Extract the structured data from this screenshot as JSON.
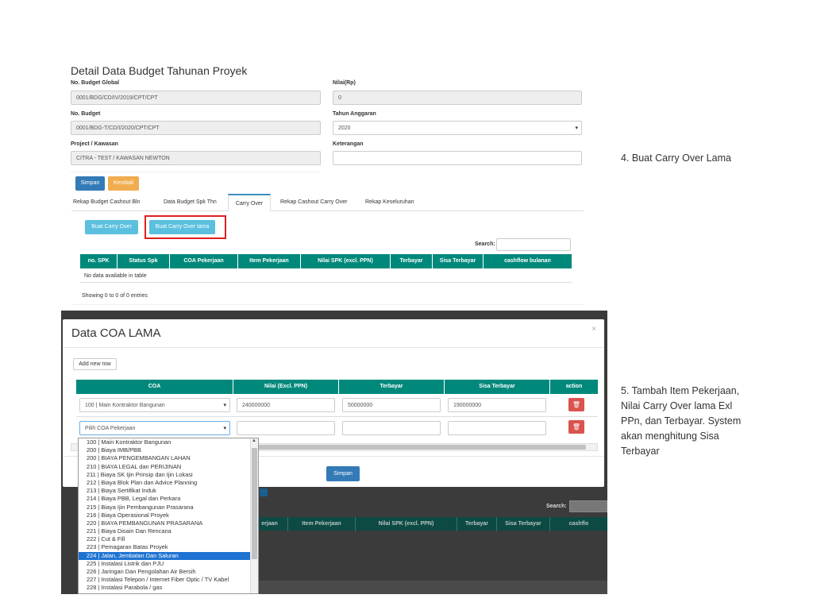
{
  "form": {
    "title": "Detail Data Budget Tahunan Proyek",
    "no_budget_global_label": "No. Budget Global",
    "no_budget_global_value": "0001/BDG/CD/IV/2019/CPT/CPT",
    "nilai_label": "Nilai(Rp)",
    "nilai_value": "0",
    "no_budget_label": "No. Budget",
    "no_budget_value": "0001/BDG-T/CD/I/2020/CPT/CPT",
    "tahun_label": "Tahun Anggaran",
    "tahun_value": "2020",
    "project_label": "Project / Kawasan",
    "project_value": "CITRA - TEST / KAWASAN NEWTON",
    "keterangan_label": "Keterangan",
    "keterangan_value": "",
    "simpan_label": "Simpan",
    "kembali_label": "Kembali"
  },
  "tabs": [
    {
      "label": "Rekap Budget Cashout Bln"
    },
    {
      "label": "Data Budget Spk Thn"
    },
    {
      "label": "Carry Over"
    },
    {
      "label": "Rekap Cashout Carry Over"
    },
    {
      "label": "Rekap Keseluruhan"
    }
  ],
  "carry_over": {
    "buat_label": "Buat Carry Over",
    "buat_lama_label": "Buat Carry Over lama",
    "search_label": "Search:",
    "columns": [
      "no. SPK",
      "Status Spk",
      "COA Pekerjaan",
      "Item Pekerjaan",
      "Nilai SPK (excl. PPN)",
      "Terbayar",
      "Sisa Terbayar",
      "cashflow bulanan"
    ],
    "empty_text": "No data available in table",
    "info_text": "Showing 0 to 0 of 0 entries"
  },
  "modal": {
    "title": "Data COA LAMA",
    "close_icon": "close-icon",
    "add_row_label": "Add new row",
    "columns": [
      "COA",
      "Nilai (Excl. PPN)",
      "Terbayar",
      "Sisa Terbayar",
      "action"
    ],
    "row1": {
      "coa": "100 | Main Kontraktor Bangunan",
      "nilai": "240000000",
      "terbayar": "50000000",
      "sisa": "190000000"
    },
    "row2": {
      "coa": "Pilih COA Pekerjaan",
      "nilai": "",
      "terbayar": "",
      "sisa": ""
    },
    "simpan_label": "Simpan",
    "dropdown_options": [
      "100 | Main Kontraktor Bangunan",
      "200 | Biaya IMB/PBB",
      "200 | BIAYA PENGEMBANGAN LAHAN",
      "210 | BIAYA LEGAL dan PERIJINAN",
      "211 | Biaya SK Ijin Prinsip dan Ijin Lokasi",
      "212 | Biaya Blok Plan dan Advice Planning",
      "213 | Biaya Sertifikat Induk",
      "214 | Biaya PBB, Legal dan Perkara",
      "215 | Biaya Ijin Pembangunan Prasarana",
      "216 | Biaya Operasional Proyek",
      "220 | BIAYA PEMBANGUNAN PRASARANA",
      "221 | Biaya Disain Dan Rencana",
      "222 | Cut & Fill",
      "223 | Pemagaran Batas Proyek",
      "224 | Jalan, Jembatan Dan Saluran",
      "225 | Instalasi Listrik dan PJU",
      "226 | Jaringan Dan Pengolahan Air Bersih",
      "227 | Instalasi Telepon / Internet Fiber Optic / TV Kabel",
      "228 | Instalasi Parabola / gas"
    ],
    "selected_option_index": 14
  },
  "background": {
    "search_label": "Search:",
    "columns": [
      "erjaan",
      "Item Pekerjaan",
      "Nilai SPK (excl. PPN)",
      "Terbayar",
      "Sisa Terbayar",
      "cashflo"
    ]
  },
  "notes": {
    "step4": "4. Buat Carry Over Lama",
    "step5_lines": [
      "5. Tambah Item Pekerjaan,",
      "Nilai Carry Over lama Exl",
      "PPn, dan Terbayar. System",
      "akan menghitung Sisa",
      "Terbayar"
    ]
  },
  "colors": {
    "primary": "#337ab7",
    "warning": "#f0ad4e",
    "info": "#5bc0de",
    "table_header": "#00897b",
    "danger": "#d9534f",
    "highlight_box": "#e02020",
    "selected_option": "#1e73d2"
  }
}
